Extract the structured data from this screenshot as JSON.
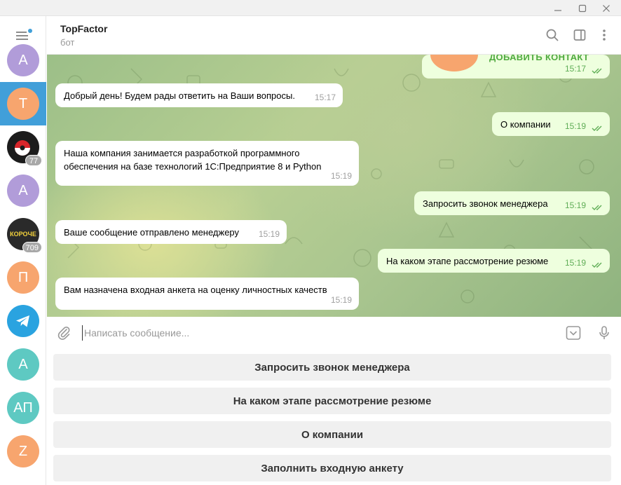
{
  "chat": {
    "title": "TopFactor",
    "status": "бот"
  },
  "sidebar": {
    "chats": [
      {
        "initials": "A",
        "color": "#b19cd9",
        "active": false,
        "badge": ""
      },
      {
        "initials": "T",
        "color": "#f7a56e",
        "active": true,
        "badge": ""
      },
      {
        "initials": "",
        "color": "#1c1c1c",
        "active": false,
        "badge": "77",
        "icon": "red-white-logo-icon"
      },
      {
        "initials": "A",
        "color": "#b19cd9",
        "active": false,
        "badge": ""
      },
      {
        "initials": "КОРОЧЕ",
        "color": "#2a2a2a",
        "active": false,
        "badge": "709"
      },
      {
        "initials": "П",
        "color": "#f7a56e",
        "active": false,
        "badge": ""
      },
      {
        "initials": "",
        "color": "#2aa3e0",
        "active": false,
        "badge": "",
        "icon": "telegram-icon"
      },
      {
        "initials": "A",
        "color": "#5ec9c2",
        "active": false,
        "badge": ""
      },
      {
        "initials": "АП",
        "color": "#5ec9c2",
        "active": false,
        "badge": ""
      },
      {
        "initials": "Z",
        "color": "#f7a56e",
        "active": false,
        "badge": ""
      }
    ]
  },
  "messages": [
    {
      "dir": "out",
      "text": "ДОБАВИТЬ КОНТАКТ",
      "time": "15:17",
      "type": "contact"
    },
    {
      "dir": "in",
      "text": "Добрый день! Будем рады ответить на Ваши вопросы.",
      "time": "15:17"
    },
    {
      "dir": "out",
      "text": "О компании",
      "time": "15:19"
    },
    {
      "dir": "in",
      "text": "Наша компания занимается разработкой программного обеспечения на базе технологий 1С:Предприятие 8 и Python",
      "time": "15:19"
    },
    {
      "dir": "out",
      "text": "Запросить звонок менеджера",
      "time": "15:19"
    },
    {
      "dir": "in",
      "text": "Ваше сообщение отправлено менеджеру",
      "time": "15:19"
    },
    {
      "dir": "out",
      "text": "На каком этапе рассмотрение резюме",
      "time": "15:19"
    },
    {
      "dir": "in",
      "text": "Вам назначена входная анкета на оценку личностных качеств",
      "time": "15:19"
    }
  ],
  "composer": {
    "placeholder": "Написать сообщение..."
  },
  "keyboard": {
    "buttons": [
      "Запросить звонок менеджера",
      "На каком этапе рассмотрение резюме",
      "О компании",
      "Заполнить входную анкету"
    ]
  },
  "colors": {
    "accent": "#419fd9",
    "outgoing_bubble": "#eeffde",
    "time_out": "#5fad56"
  }
}
